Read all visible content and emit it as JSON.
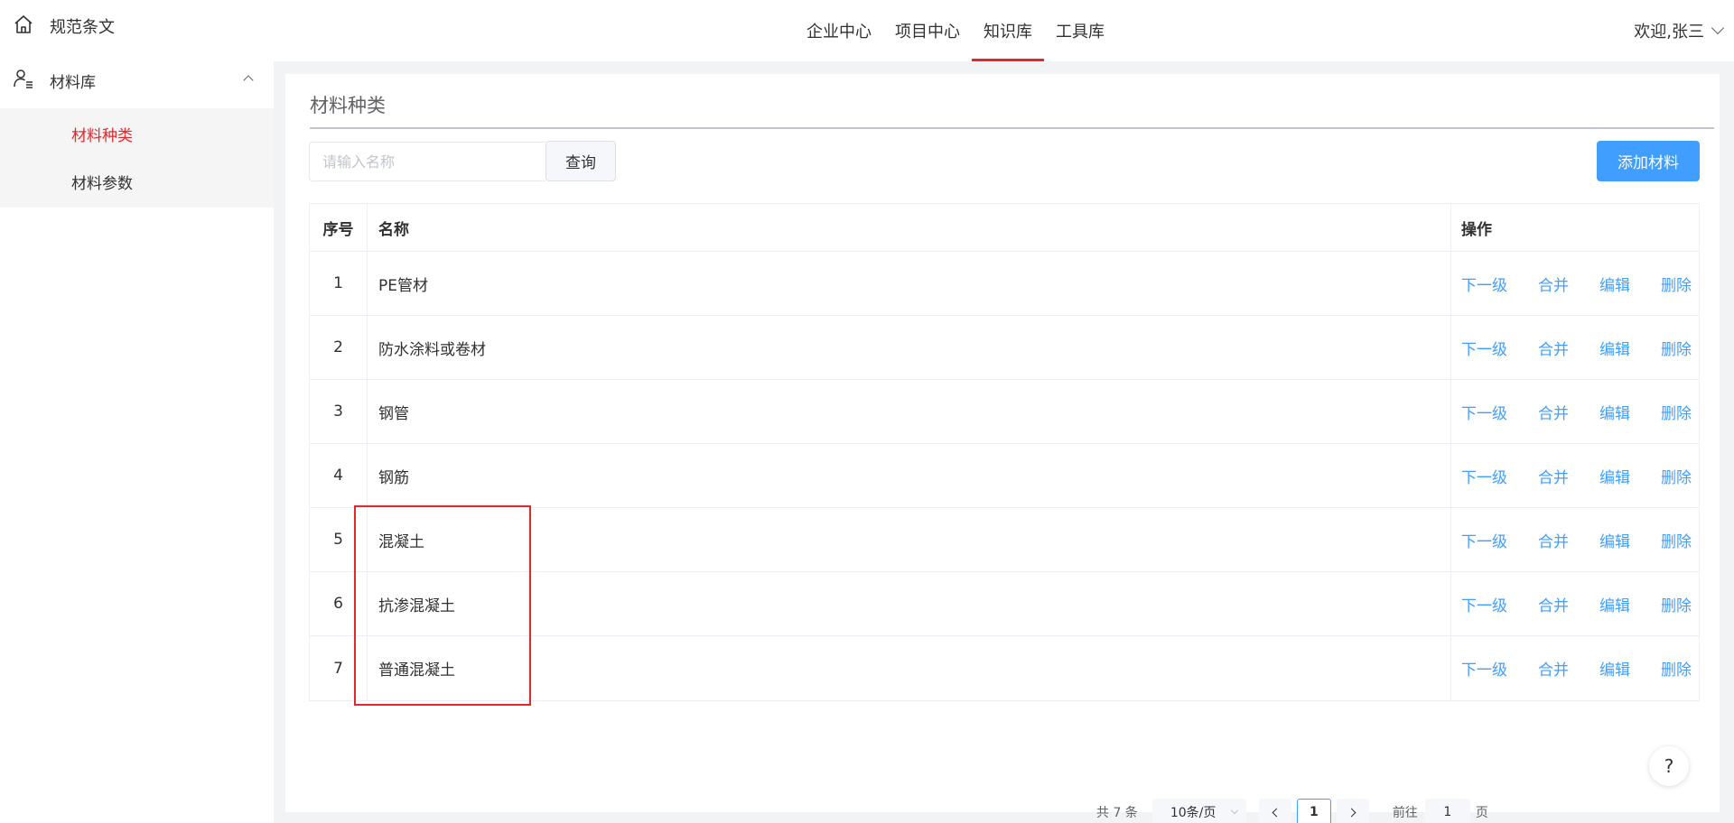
{
  "colors": {
    "accent": "#e5262b",
    "link": "#409eff",
    "primary_button": "#409eff"
  },
  "topnav": {
    "items": [
      {
        "label": "企业中心"
      },
      {
        "label": "项目中心"
      },
      {
        "label": "知识库",
        "active": true
      },
      {
        "label": "工具库"
      }
    ]
  },
  "user": {
    "greeting": "欢迎,张三"
  },
  "sidebar": {
    "top_item": {
      "label": "规范条文",
      "icon": "home-icon"
    },
    "group": {
      "label": "材料库",
      "icon": "user-list-icon",
      "expanded": true
    },
    "sub_items": [
      {
        "label": "材料种类",
        "active": true
      },
      {
        "label": "材料参数"
      }
    ]
  },
  "main": {
    "title": "材料种类",
    "search": {
      "placeholder": "请输入名称",
      "button": "查询"
    },
    "add_button": "添加材料",
    "table": {
      "columns": [
        "序号",
        "名称",
        "操作"
      ],
      "rows": [
        {
          "idx": "1",
          "name": "PE管材"
        },
        {
          "idx": "2",
          "name": "防水涂料或卷材"
        },
        {
          "idx": "3",
          "name": "钢管"
        },
        {
          "idx": "4",
          "name": "钢筋"
        },
        {
          "idx": "5",
          "name": "混凝土"
        },
        {
          "idx": "6",
          "name": "抗渗混凝土"
        },
        {
          "idx": "7",
          "name": "普通混凝土"
        }
      ],
      "actions": [
        "下一级",
        "合并",
        "编辑",
        "删除"
      ]
    },
    "pagination": {
      "total": "共 7 条",
      "page_size": "10条/页",
      "current_page": "1",
      "goto_label": "前往",
      "goto_value": "1",
      "page_suffix": "页"
    }
  },
  "help": {
    "label": "?"
  }
}
